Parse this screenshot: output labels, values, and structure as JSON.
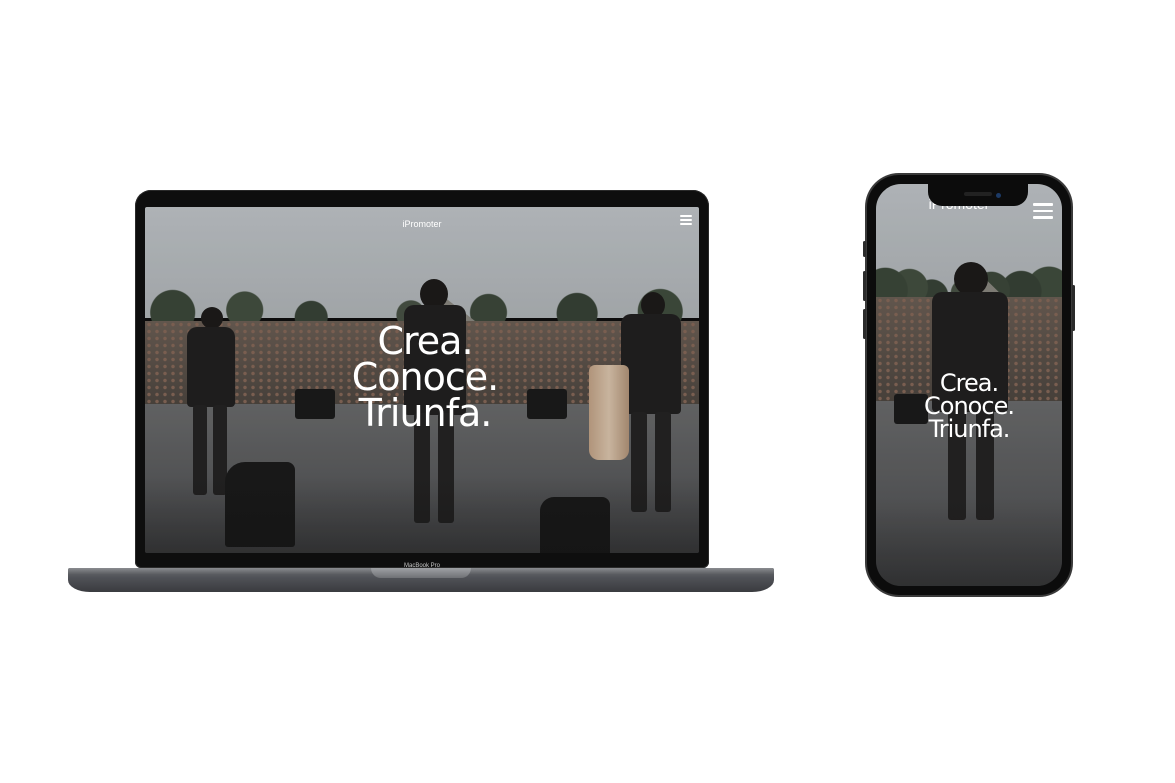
{
  "site": {
    "brand": "iPromoter",
    "headline": [
      "Crea.",
      "Conoce.",
      "Triunfa."
    ]
  },
  "laptop": {
    "model_label": "MacBook Pro"
  },
  "icons": {
    "menu": "hamburger-menu-icon"
  },
  "colors": {
    "background": "#ffffff",
    "device_frame": "#0e0e0e",
    "text": "#ffffff"
  }
}
